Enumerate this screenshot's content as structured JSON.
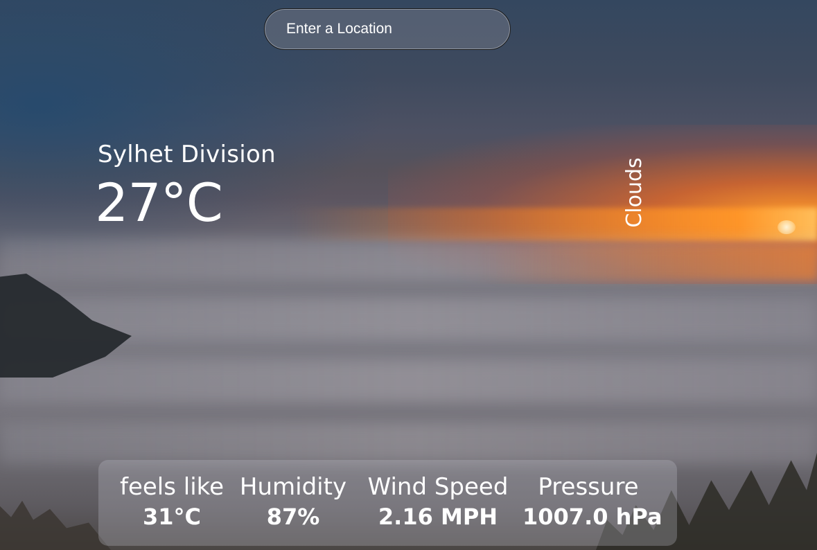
{
  "search": {
    "placeholder": "Enter a Location",
    "value": ""
  },
  "weather": {
    "location": "Sylhet Division",
    "temperature": "27°C",
    "condition": "Clouds"
  },
  "stats": [
    {
      "label": "feels like",
      "value": "31°C"
    },
    {
      "label": "Humidity",
      "value": "87%"
    },
    {
      "label": "Wind Speed",
      "value": "2.16 MPH"
    },
    {
      "label": "Pressure",
      "value": "1007.0 hPa"
    }
  ],
  "colors": {
    "text": "#ffffff",
    "search_border": "#1a1a1a",
    "panel_tint": "rgba(190,190,200,0.30)"
  }
}
